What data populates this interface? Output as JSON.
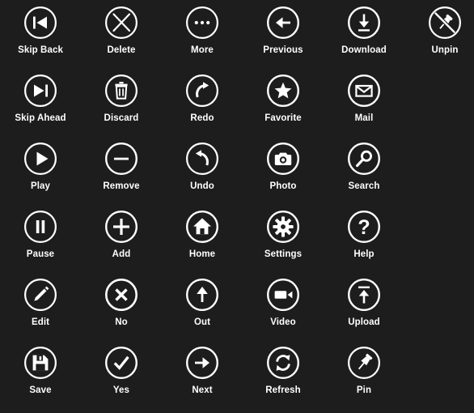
{
  "page": {
    "title": "Icon Set",
    "background_color": "#1d1d1d",
    "icon_color": "#ffffff",
    "label_color": "#ffffff",
    "columns": 6,
    "rows": 6
  },
  "icons": [
    {
      "label": "Skip Back",
      "icon": "skip-back-icon",
      "shape": "skipback"
    },
    {
      "label": "Delete",
      "icon": "delete-icon",
      "shape": "x-thin"
    },
    {
      "label": "More",
      "icon": "more-icon",
      "shape": "dots"
    },
    {
      "label": "Previous",
      "icon": "previous-icon",
      "shape": "arrow-left"
    },
    {
      "label": "Download",
      "icon": "download-icon",
      "shape": "download"
    },
    {
      "label": "Unpin",
      "icon": "unpin-icon",
      "shape": "unpin"
    },
    {
      "label": "Skip Ahead",
      "icon": "skip-ahead-icon",
      "shape": "skipahead"
    },
    {
      "label": "Discard",
      "icon": "discard-icon",
      "shape": "trash"
    },
    {
      "label": "Redo",
      "icon": "redo-icon",
      "shape": "redo"
    },
    {
      "label": "Favorite",
      "icon": "favorite-icon",
      "shape": "star"
    },
    {
      "label": "Mail",
      "icon": "mail-icon",
      "shape": "mail"
    },
    {
      "label": "",
      "icon": "empty-cell",
      "shape": "none"
    },
    {
      "label": "Play",
      "icon": "play-icon",
      "shape": "play"
    },
    {
      "label": "Remove",
      "icon": "remove-icon",
      "shape": "minus"
    },
    {
      "label": "Undo",
      "icon": "undo-icon",
      "shape": "undo"
    },
    {
      "label": "Photo",
      "icon": "photo-icon",
      "shape": "camera"
    },
    {
      "label": "Search",
      "icon": "search-icon",
      "shape": "magnifier"
    },
    {
      "label": "",
      "icon": "empty-cell",
      "shape": "none"
    },
    {
      "label": "Pause",
      "icon": "pause-icon",
      "shape": "pause"
    },
    {
      "label": "Add",
      "icon": "add-icon",
      "shape": "plus"
    },
    {
      "label": "Home",
      "icon": "home-icon",
      "shape": "house"
    },
    {
      "label": "Settings",
      "icon": "settings-icon",
      "shape": "gear"
    },
    {
      "label": "Help",
      "icon": "help-icon",
      "shape": "question"
    },
    {
      "label": "",
      "icon": "empty-cell",
      "shape": "none"
    },
    {
      "label": "Edit",
      "icon": "edit-icon",
      "shape": "pencil"
    },
    {
      "label": "No",
      "icon": "no-icon",
      "shape": "x-bold"
    },
    {
      "label": "Out",
      "icon": "out-icon",
      "shape": "arrow-up"
    },
    {
      "label": "Video",
      "icon": "video-icon",
      "shape": "camcorder"
    },
    {
      "label": "Upload",
      "icon": "upload-icon",
      "shape": "upload"
    },
    {
      "label": "",
      "icon": "empty-cell",
      "shape": "none"
    },
    {
      "label": "Save",
      "icon": "save-icon",
      "shape": "floppy"
    },
    {
      "label": "Yes",
      "icon": "yes-icon",
      "shape": "check"
    },
    {
      "label": "Next",
      "icon": "next-icon",
      "shape": "arrow-right"
    },
    {
      "label": "Refresh",
      "icon": "refresh-icon",
      "shape": "refresh"
    },
    {
      "label": "Pin",
      "icon": "pin-icon",
      "shape": "pin"
    },
    {
      "label": "",
      "icon": "empty-cell",
      "shape": "none"
    }
  ]
}
